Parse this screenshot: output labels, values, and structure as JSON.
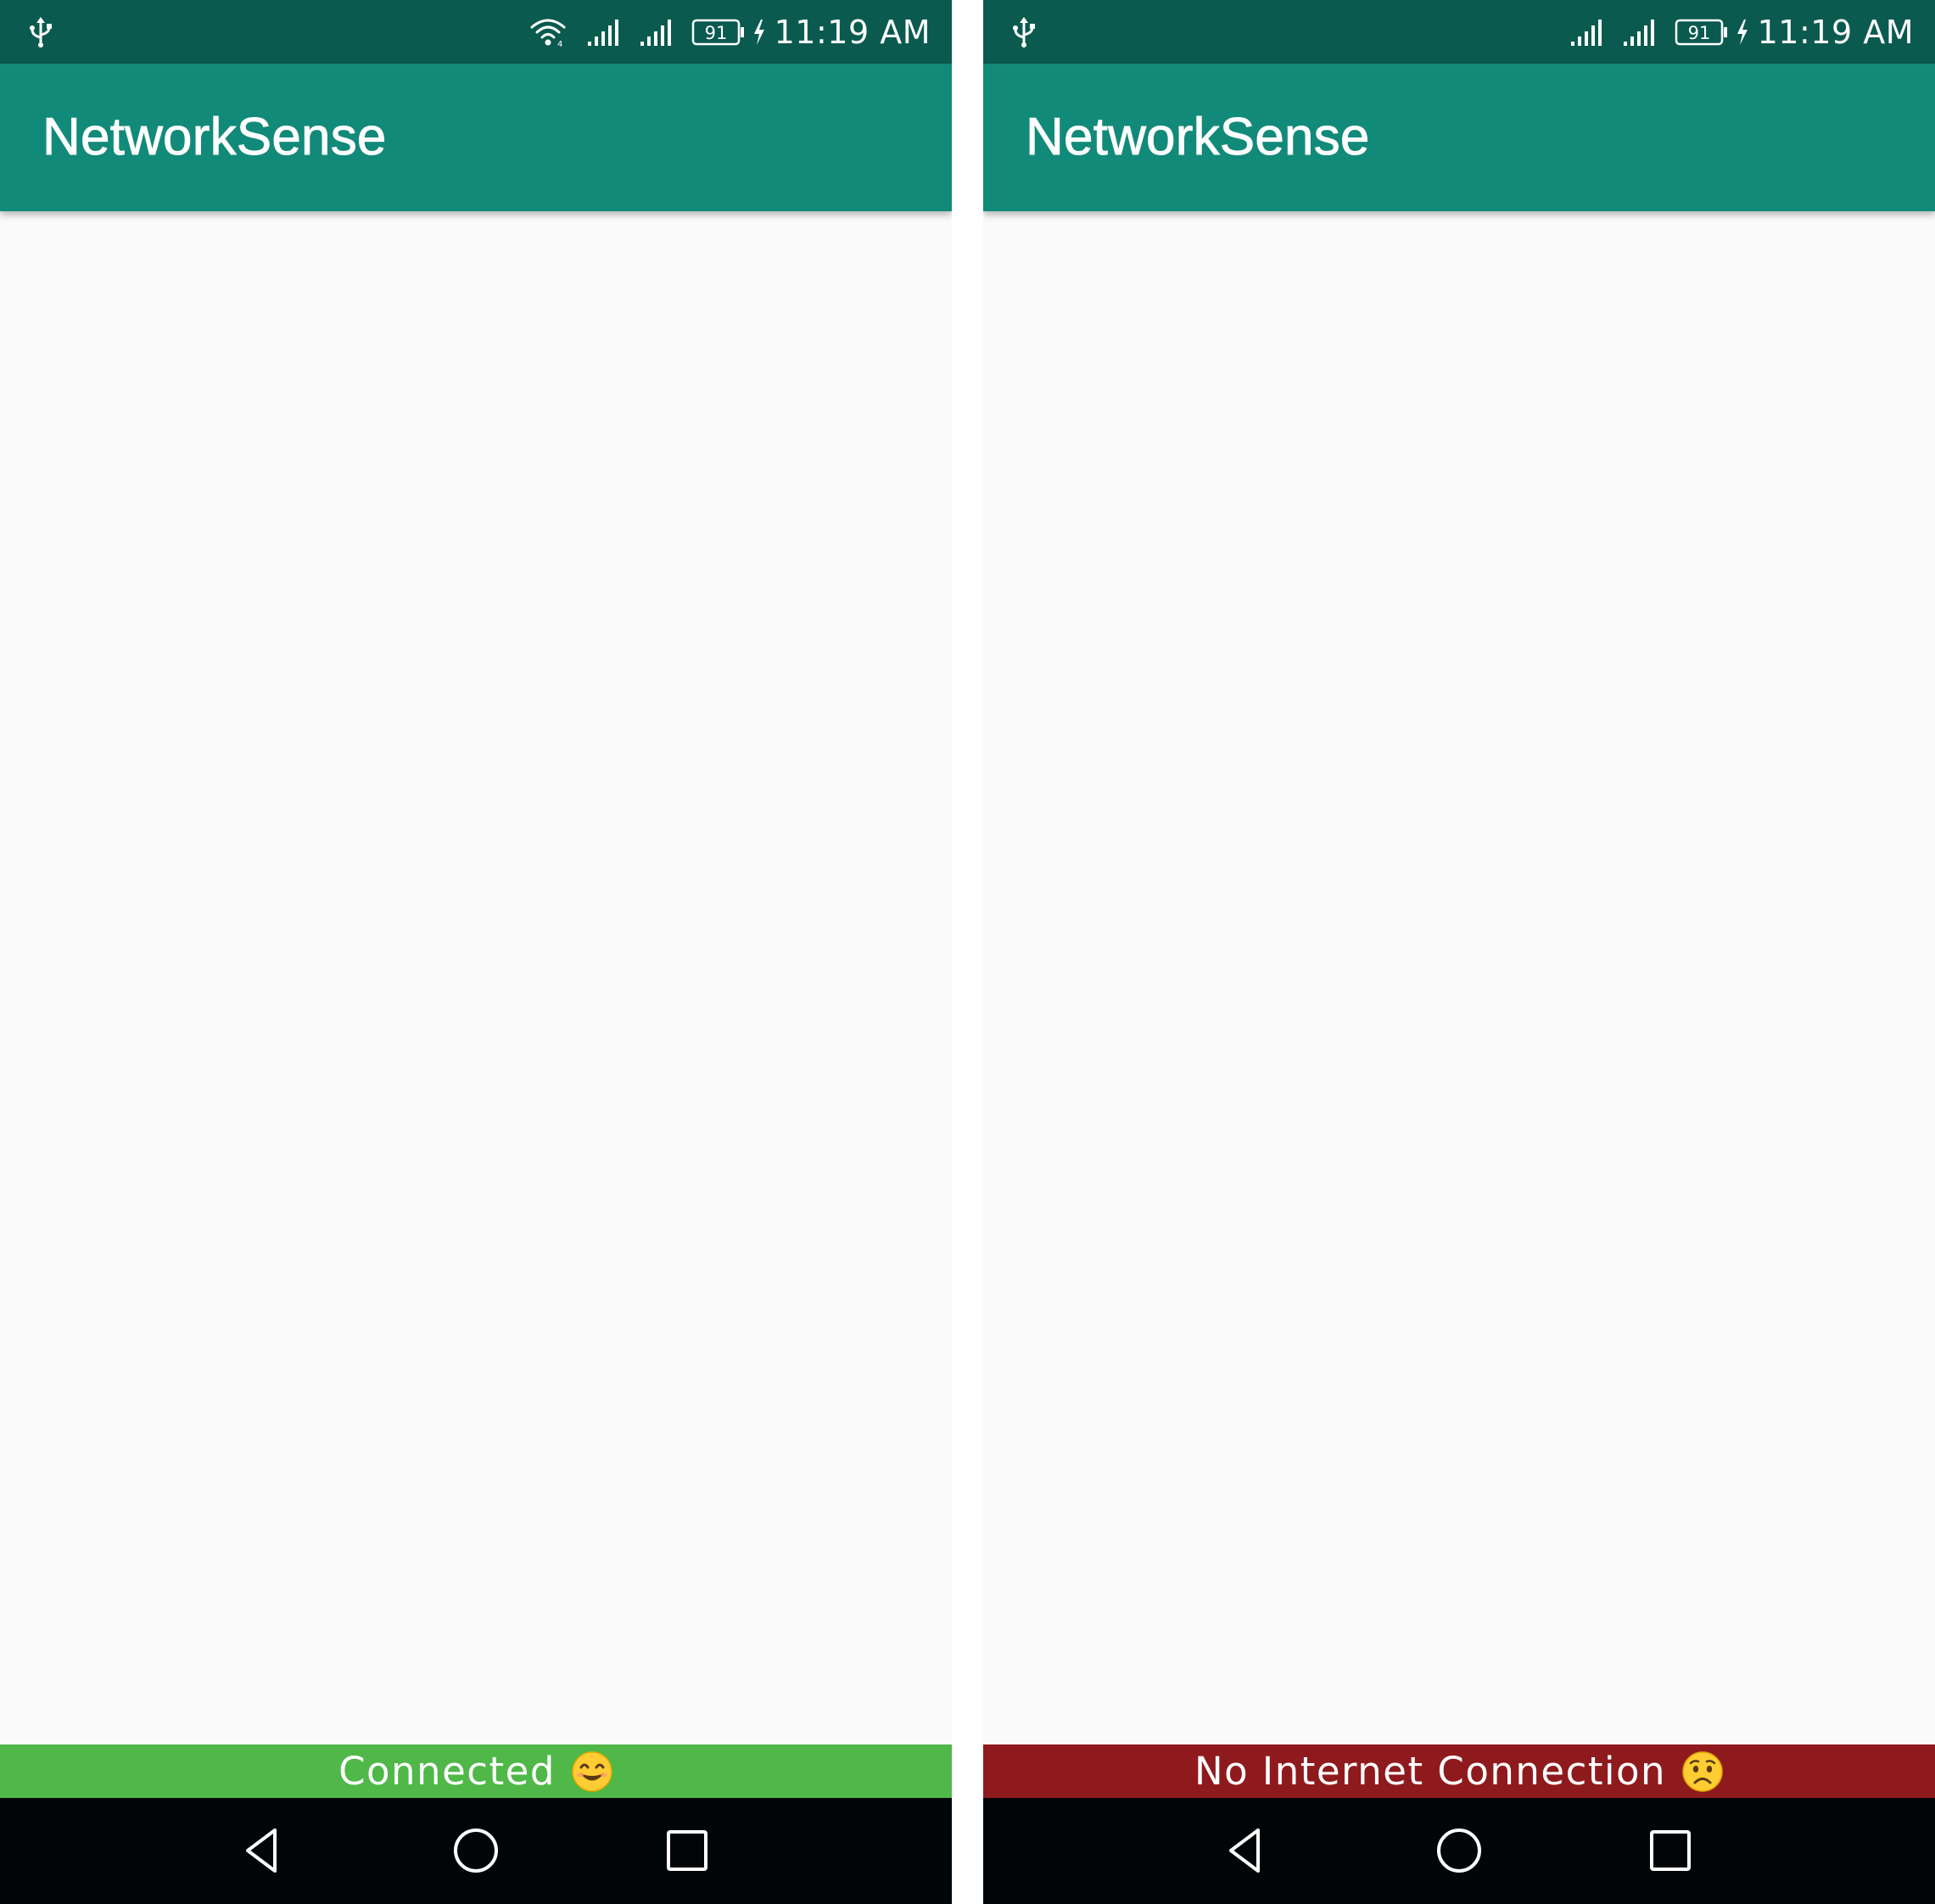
{
  "screens": [
    {
      "status_bar": {
        "time": "11:19 AM",
        "battery_level": "91",
        "icons": [
          "usb-icon",
          "wifi-icon",
          "signal-icon",
          "signal-icon",
          "battery-icon",
          "charging-bolt-icon"
        ]
      },
      "app_bar": {
        "title": "NetworkSense"
      },
      "banner": {
        "text": "Connected",
        "emoji": "smiling-face-icon",
        "color": "#4fb848"
      },
      "nav_bar": {
        "buttons": [
          "back-icon",
          "home-icon",
          "recents-icon"
        ]
      }
    },
    {
      "status_bar": {
        "time": "11:19 AM",
        "battery_level": "91",
        "icons": [
          "usb-icon",
          "signal-icon",
          "signal-icon",
          "battery-icon",
          "charging-bolt-icon"
        ]
      },
      "app_bar": {
        "title": "NetworkSense"
      },
      "banner": {
        "text": "No Internet Connection",
        "emoji": "worried-face-icon",
        "color": "#8f1a1d"
      },
      "nav_bar": {
        "buttons": [
          "back-icon",
          "home-icon",
          "recents-icon"
        ]
      }
    }
  ],
  "colors": {
    "status_bar": "#0b5a4f",
    "app_bar": "#128a79",
    "content_background": "#fafafa",
    "nav_bar": "#020507"
  }
}
